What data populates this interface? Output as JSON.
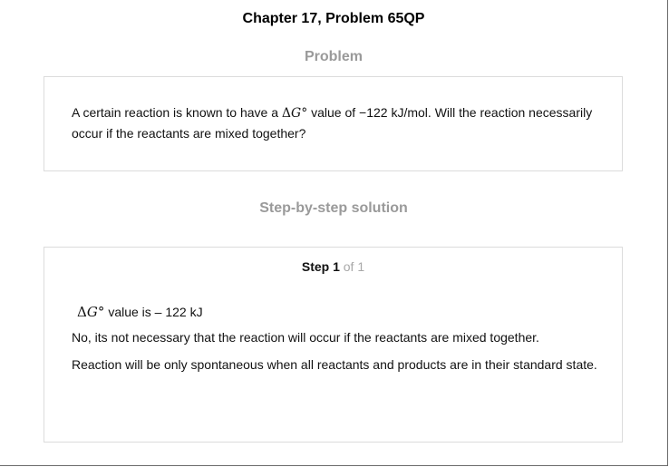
{
  "title": "Chapter 17, Problem 65QP",
  "problem": {
    "heading": "Problem",
    "text_before": "A certain reaction is known to have a ",
    "delta_symbol": "Δ",
    "g_symbol": "G",
    "degree_symbol": "°",
    "text_after": " value of −122 kJ/mol. Will the reaction necessarily occur if the reactants are mixed together?"
  },
  "solution": {
    "heading": "Step-by-step solution",
    "step_label": "Step 1",
    "step_total": " of 1",
    "delta_symbol": "Δ",
    "g_symbol": "G",
    "degree_symbol": "°",
    "line1_text": "value is – 122 kJ",
    "line2_text": "No, its not necessary that the reaction will occur if the reactants are mixed together.",
    "line3_text": "Reaction will be only spontaneous when all reactants and products are in their standard state."
  }
}
